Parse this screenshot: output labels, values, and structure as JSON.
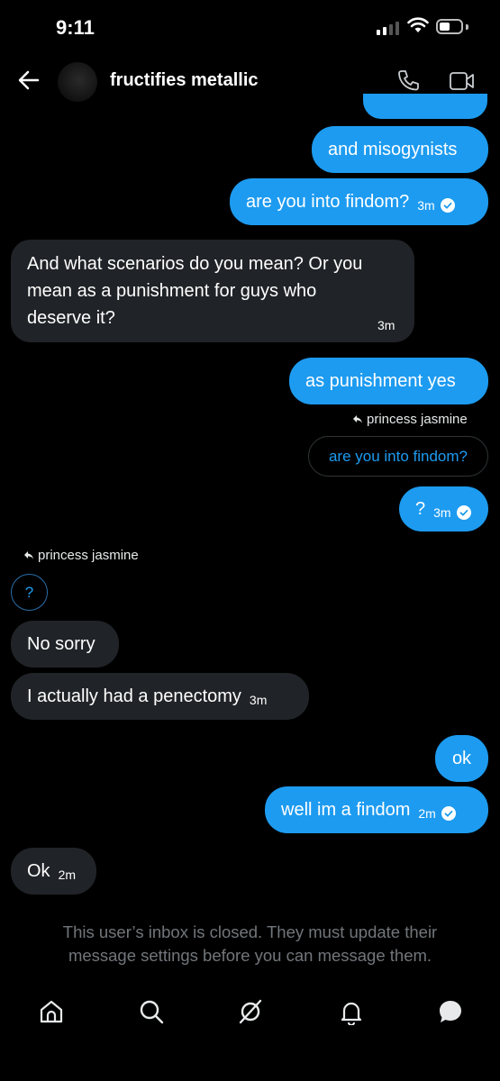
{
  "status_bar": {
    "time": "9:11"
  },
  "header": {
    "title": "fructifies metallic"
  },
  "messages": [
    {
      "text": "and misogynists"
    },
    {
      "text": "are you into findom?",
      "time": "3m"
    },
    {
      "text_line1": "And what scenarios do you mean? Or you",
      "text_line2": "mean as a punishment for guys who",
      "text_line3": "deserve it?",
      "time": "3m"
    },
    {
      "text": "as punishment yes"
    },
    {
      "reply_to": "princess jasmine",
      "quote": "are you into findom?"
    },
    {
      "text": "?",
      "time": "3m"
    },
    {
      "reply_to": "princess jasmine",
      "quote": "?"
    },
    {
      "text": "No sorry"
    },
    {
      "text": "I actually had a penectomy",
      "time": "3m"
    },
    {
      "text": "ok"
    },
    {
      "text": "well im a findom",
      "time": "2m"
    },
    {
      "text": "Ok",
      "time": "2m"
    }
  ],
  "notice": {
    "line1": "This user’s inbox is closed. They must update their",
    "line2": "message settings before you can message them."
  },
  "icons": {
    "back": "arrow-left-icon",
    "phone": "phone-icon",
    "video": "video-icon",
    "home": "home-icon",
    "search": "search-icon",
    "grok": "grok-icon",
    "notifications": "bell-icon",
    "messages": "chat-bubble-icon"
  },
  "colors": {
    "accent": "#1d9bf0",
    "incoming": "#202327",
    "background": "#000000",
    "muted": "#71767b"
  }
}
